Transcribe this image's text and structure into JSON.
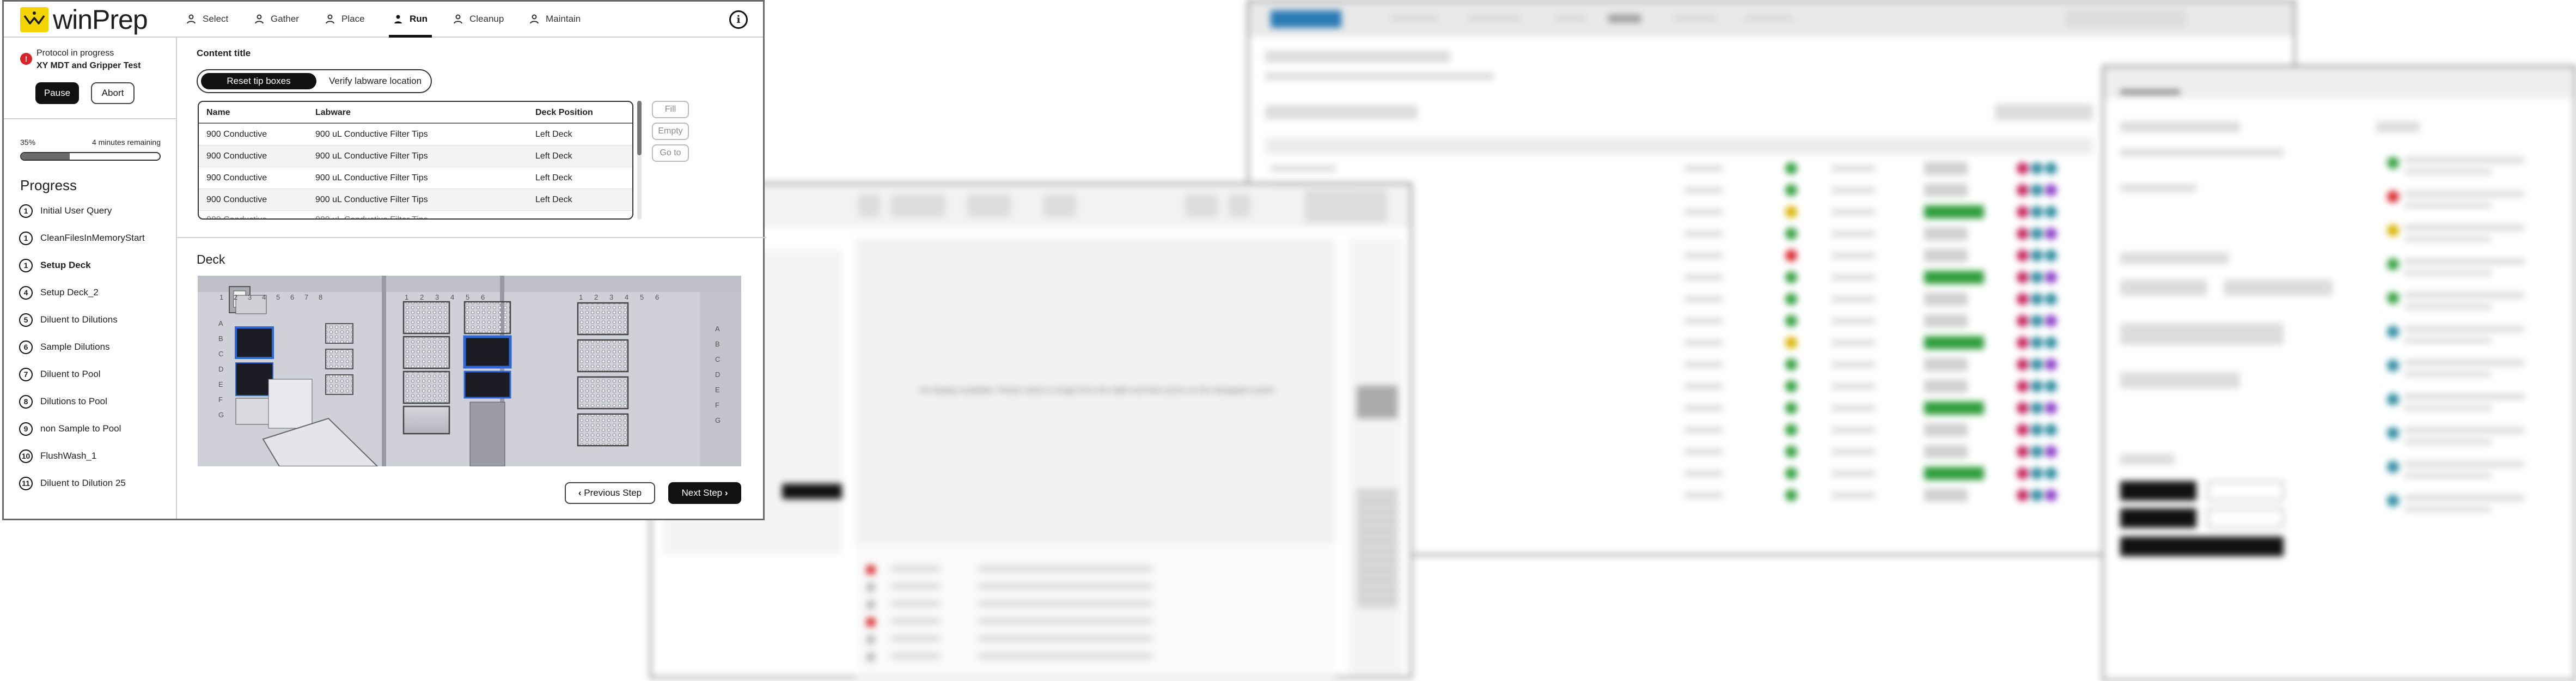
{
  "winprep": {
    "brand": "winPrep",
    "nav": [
      {
        "label": "Select",
        "icon": "cursor-icon"
      },
      {
        "label": "Gather",
        "icon": "flask-icon"
      },
      {
        "label": "Place",
        "icon": "person-icon"
      },
      {
        "label": "Run",
        "icon": "person-run-icon",
        "active": true
      },
      {
        "label": "Cleanup",
        "icon": "person-icon"
      },
      {
        "label": "Maintain",
        "icon": "person-icon"
      }
    ],
    "info_label": "i",
    "status": {
      "alert": "!",
      "line1": "Protocol in progress",
      "line2": "XY MDT and Gripper Test",
      "pause": "Pause",
      "abort": "Abort"
    },
    "progress": {
      "percent_text": "35%",
      "remaining": "4 minutes remaining",
      "fraction": 0.35
    },
    "progress_title": "Progress",
    "steps": [
      {
        "n": "1",
        "label": "Initial User Query"
      },
      {
        "n": "1",
        "label": "CleanFilesInMemoryStart"
      },
      {
        "n": "1",
        "label": "Setup Deck",
        "current": true
      },
      {
        "n": "4",
        "label": "Setup Deck_2"
      },
      {
        "n": "5",
        "label": "Diluent to Dilutions"
      },
      {
        "n": "6",
        "label": "Sample Dilutions"
      },
      {
        "n": "7",
        "label": "Diluent to Pool"
      },
      {
        "n": "8",
        "label": "Dilutions to Pool"
      },
      {
        "n": "9",
        "label": "non Sample to Pool"
      },
      {
        "n": "10",
        "label": "FlushWash_1"
      },
      {
        "n": "11",
        "label": "Diluent to Dilution 25"
      }
    ],
    "content_title": "Content title",
    "segments": {
      "active": "Reset tip boxes",
      "inactive": "Verify labware location"
    },
    "table": {
      "headers": [
        "Name",
        "Labware",
        "Deck Position"
      ],
      "rows": [
        [
          "900 Conductive",
          "900 uL Conductive Filter Tips",
          "Left Deck"
        ],
        [
          "900 Conductive",
          "900 uL Conductive Filter Tips",
          "Left Deck"
        ],
        [
          "900 Conductive",
          "900 uL Conductive Filter Tips",
          "Left Deck"
        ],
        [
          "900 Conductive",
          "900 uL Conductive Filter Tips",
          "Left Deck"
        ]
      ]
    },
    "side_actions": {
      "fill": "Fill",
      "empty": "Empty",
      "goto": "Go to"
    },
    "deck_title": "Deck",
    "deck_columns_a": [
      "1",
      "2",
      "3",
      "4",
      "5",
      "6",
      "7",
      "8"
    ],
    "deck_columns_b": [
      "1",
      "2",
      "3",
      "4",
      "5",
      "6"
    ],
    "deck_columns_c": [
      "1",
      "2",
      "3",
      "4",
      "5",
      "6"
    ],
    "deck_rows_left": [
      "A",
      "B",
      "C",
      "D",
      "E",
      "F",
      "G"
    ],
    "deck_rows_right": [
      "A",
      "B",
      "C",
      "D",
      "E",
      "F",
      "G"
    ],
    "prev_step": "Previous Step",
    "next_step": "Next Step"
  },
  "blurred_windows": {
    "center_message": "No display available. Please select a image from the table and then press on the Navigation panel."
  },
  "colors": {
    "brand_yellow": "#f3d400",
    "alert_red": "#d7262b",
    "deck_blue": "#2f67d6"
  }
}
